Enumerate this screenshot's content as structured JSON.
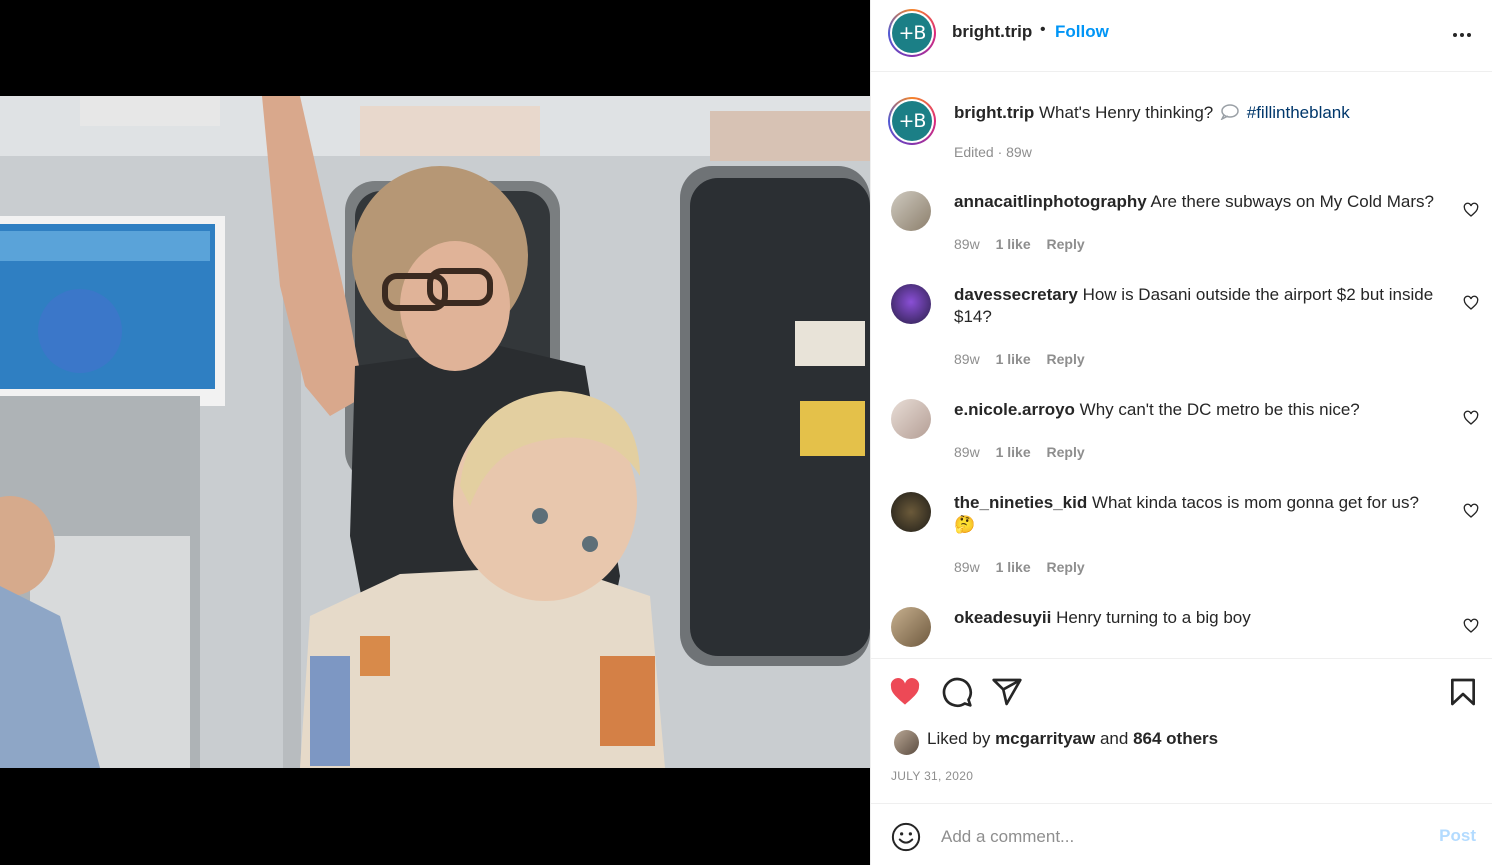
{
  "post": {
    "account": "bright.trip",
    "logo_text": "+B",
    "follow_label": "Follow",
    "separator": "•",
    "caption": {
      "username": "bright.trip",
      "text": "What's Henry thinking?",
      "hashtag": "#fillintheblank",
      "meta": "Edited · 89w"
    },
    "photo_icon": "subway-photo"
  },
  "comments": [
    {
      "username": "annacaitlinphotography",
      "text": "Are there subways on My Cold Mars?",
      "age": "89w",
      "likes": "1 like",
      "reply": "Reply"
    },
    {
      "username": "davessecretary",
      "text": "How is Dasani outside the airport $2 but inside $14?",
      "age": "89w",
      "likes": "1 like",
      "reply": "Reply"
    },
    {
      "username": "e.nicole.arroyo",
      "text": "Why can't the DC metro be this nice?",
      "age": "89w",
      "likes": "1 like",
      "reply": "Reply"
    },
    {
      "username": "the_nineties_kid",
      "text": "What kinda tacos is mom gonna get for us?",
      "emoji": "🤔",
      "age": "89w",
      "likes": "1 like",
      "reply": "Reply"
    },
    {
      "username": "okeadesuyii",
      "text": "Henry turning to a big boy"
    }
  ],
  "likes": {
    "prefix": "Liked by",
    "user": "mcgarrityaw",
    "joiner": "and",
    "others": "864 others"
  },
  "date": "JULY 31, 2020",
  "add_comment": {
    "placeholder": "Add a comment...",
    "post_label": "Post"
  },
  "colors": {
    "accent": "#0095f6",
    "like_red": "#ed4956",
    "hashtag": "#00376b",
    "muted": "#8e8e8e"
  },
  "icons": [
    "more-icon",
    "heart-icon",
    "comment-icon",
    "share-icon",
    "bookmark-icon",
    "emoji-icon",
    "small-heart-icon",
    "speech-bubble-icon"
  ]
}
